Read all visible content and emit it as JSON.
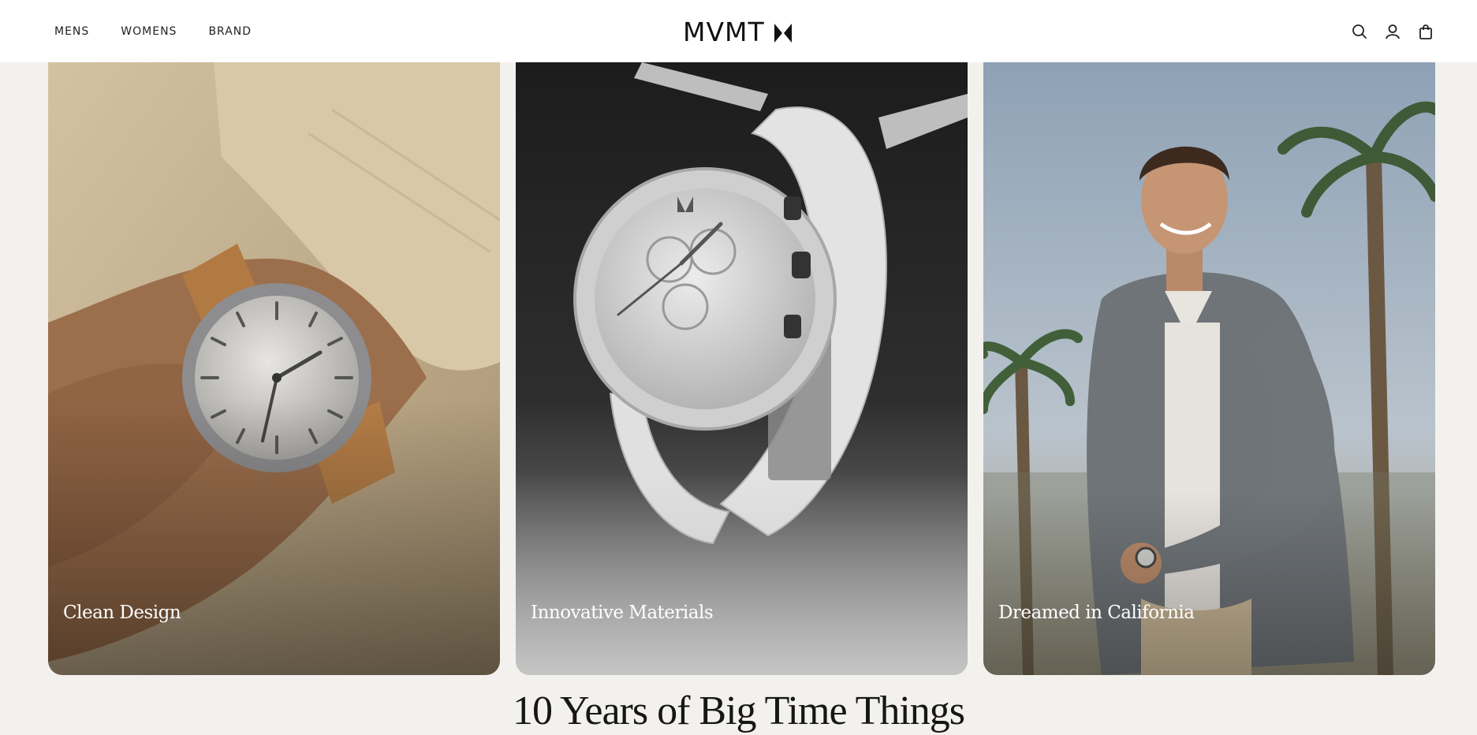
{
  "header": {
    "nav": [
      "MENS",
      "WOMENS",
      "BRAND"
    ],
    "brand": "MVMT",
    "icons": [
      "search-icon",
      "account-icon",
      "cart-icon"
    ]
  },
  "cards": [
    {
      "label": "Clean Design"
    },
    {
      "label": "Innovative Materials"
    },
    {
      "label": "Dreamed in California"
    }
  ],
  "headline": "10 Years of Big Time Things",
  "colors": {
    "page_background": "#f3f1ed",
    "header_background": "#ffffff",
    "text_dark": "#111111"
  }
}
